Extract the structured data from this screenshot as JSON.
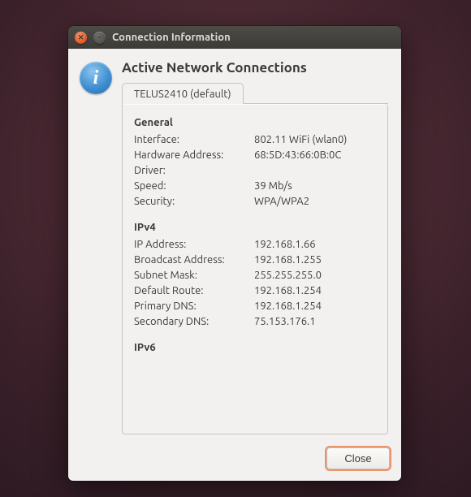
{
  "window": {
    "title": "Connection Information"
  },
  "page": {
    "heading": "Active Network Connections"
  },
  "tabs": [
    {
      "label": "TELUS2410 (default)"
    }
  ],
  "sections": {
    "general": {
      "title": "General",
      "rows": [
        {
          "key": "Interface:",
          "value": "802.11 WiFi (wlan0)"
        },
        {
          "key": "Hardware Address:",
          "value": "68:5D:43:66:0B:0C"
        },
        {
          "key": "Driver:",
          "value": ""
        },
        {
          "key": "Speed:",
          "value": "39 Mb/s"
        },
        {
          "key": "Security:",
          "value": "WPA/WPA2"
        }
      ]
    },
    "ipv4": {
      "title": "IPv4",
      "rows": [
        {
          "key": "IP Address:",
          "value": "192.168.1.66"
        },
        {
          "key": "Broadcast Address:",
          "value": "192.168.1.255"
        },
        {
          "key": "Subnet Mask:",
          "value": "255.255.255.0"
        },
        {
          "key": "Default Route:",
          "value": "192.168.1.254"
        },
        {
          "key": "Primary DNS:",
          "value": "192.168.1.254"
        },
        {
          "key": "Secondary DNS:",
          "value": "75.153.176.1"
        }
      ]
    },
    "ipv6": {
      "title": "IPv6",
      "rows": []
    }
  },
  "buttons": {
    "close": "Close"
  },
  "icons": {
    "info_glyph": "i",
    "close_glyph": "✕",
    "min_glyph": "–"
  }
}
